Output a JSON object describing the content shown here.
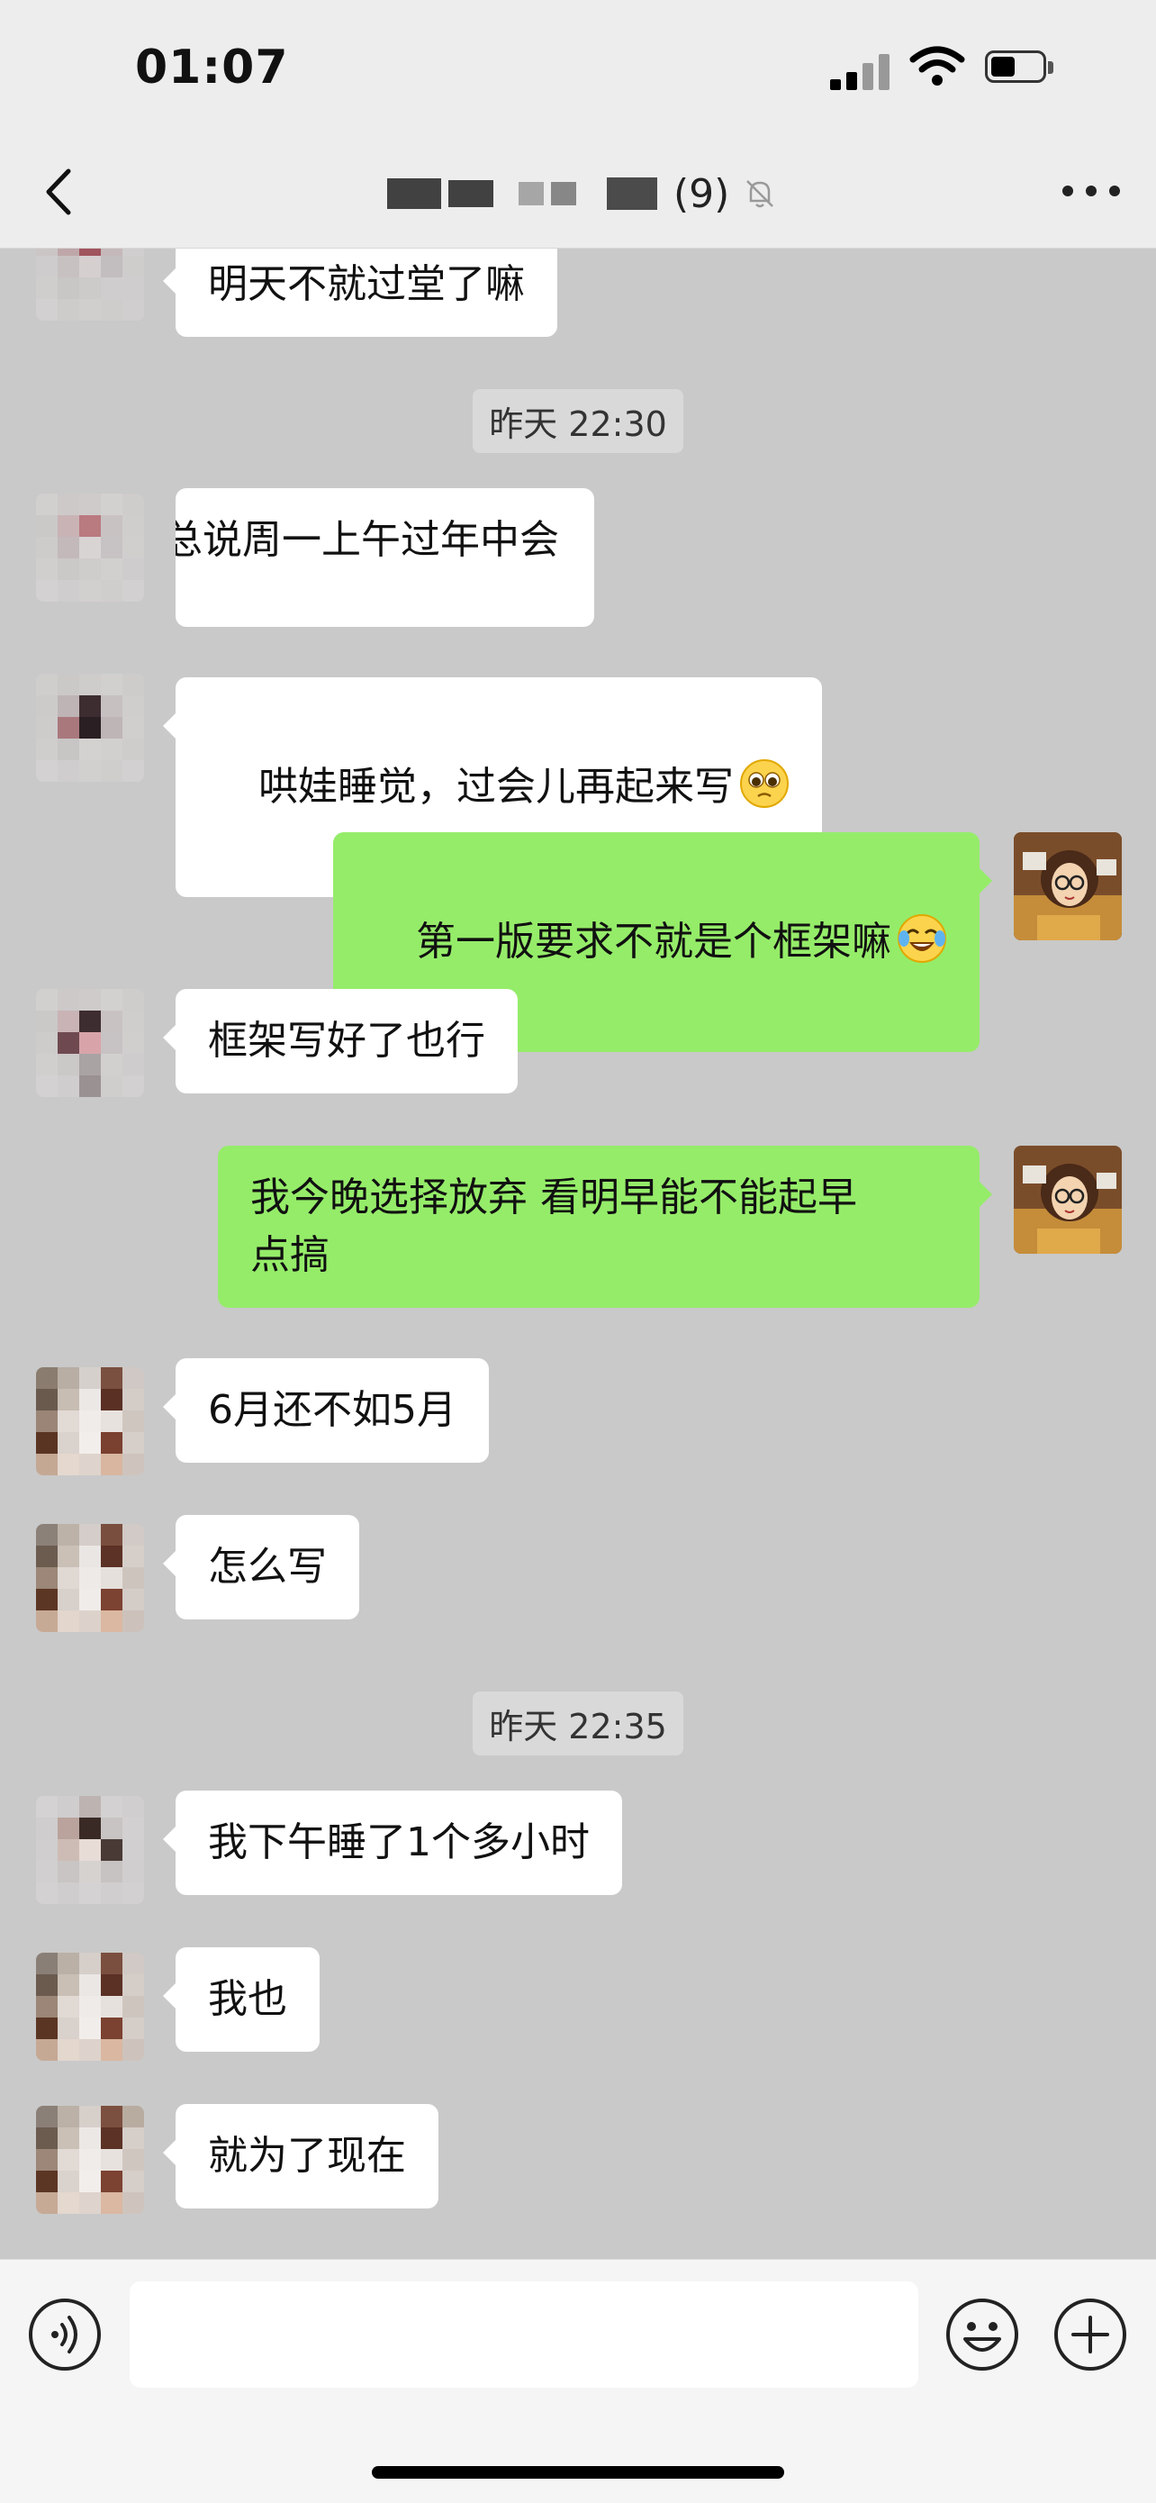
{
  "status_bar": {
    "time": "01:07"
  },
  "header": {
    "member_count": "(9)",
    "icons": [
      "back-icon",
      "mute-bell-icon",
      "more-icon"
    ]
  },
  "messages": [
    {
      "type": "text",
      "side": "left",
      "text": "明天不就过堂了嘛"
    },
    {
      "type": "time",
      "text": "昨天 22:30"
    },
    {
      "type": "text",
      "side": "left",
      "text": "总说周一上午过年中会"
    },
    {
      "type": "text",
      "side": "left",
      "text": "哄娃睡觉，过会儿再起来写",
      "emoji": "pleading-face"
    },
    {
      "type": "text",
      "side": "right",
      "text": "第一版要求不就是个框架嘛",
      "emoji": "tears-of-joy"
    },
    {
      "type": "text",
      "side": "left",
      "text": "框架写好了也行"
    },
    {
      "type": "text",
      "side": "right",
      "text": "我今晚选择放弃 看明早能不能起早\n点搞"
    },
    {
      "type": "text",
      "side": "left",
      "text": "6月还不如5月"
    },
    {
      "type": "text",
      "side": "left",
      "text": "怎么写"
    },
    {
      "type": "time",
      "text": "昨天 22:35"
    },
    {
      "type": "text",
      "side": "left",
      "text": "我下午睡了1个多小时"
    },
    {
      "type": "text",
      "side": "left",
      "text": "我也"
    },
    {
      "type": "text",
      "side": "left",
      "text": "就为了现在"
    }
  ],
  "input_bar": {
    "placeholder": "",
    "icons": [
      "voice-icon",
      "emoji-icon",
      "plus-icon"
    ]
  },
  "colors": {
    "chat_background": "#c9c9c9",
    "incoming_bubble": "#ffffff",
    "outgoing_bubble": "#95ec69",
    "bar_background": "#ededed"
  }
}
